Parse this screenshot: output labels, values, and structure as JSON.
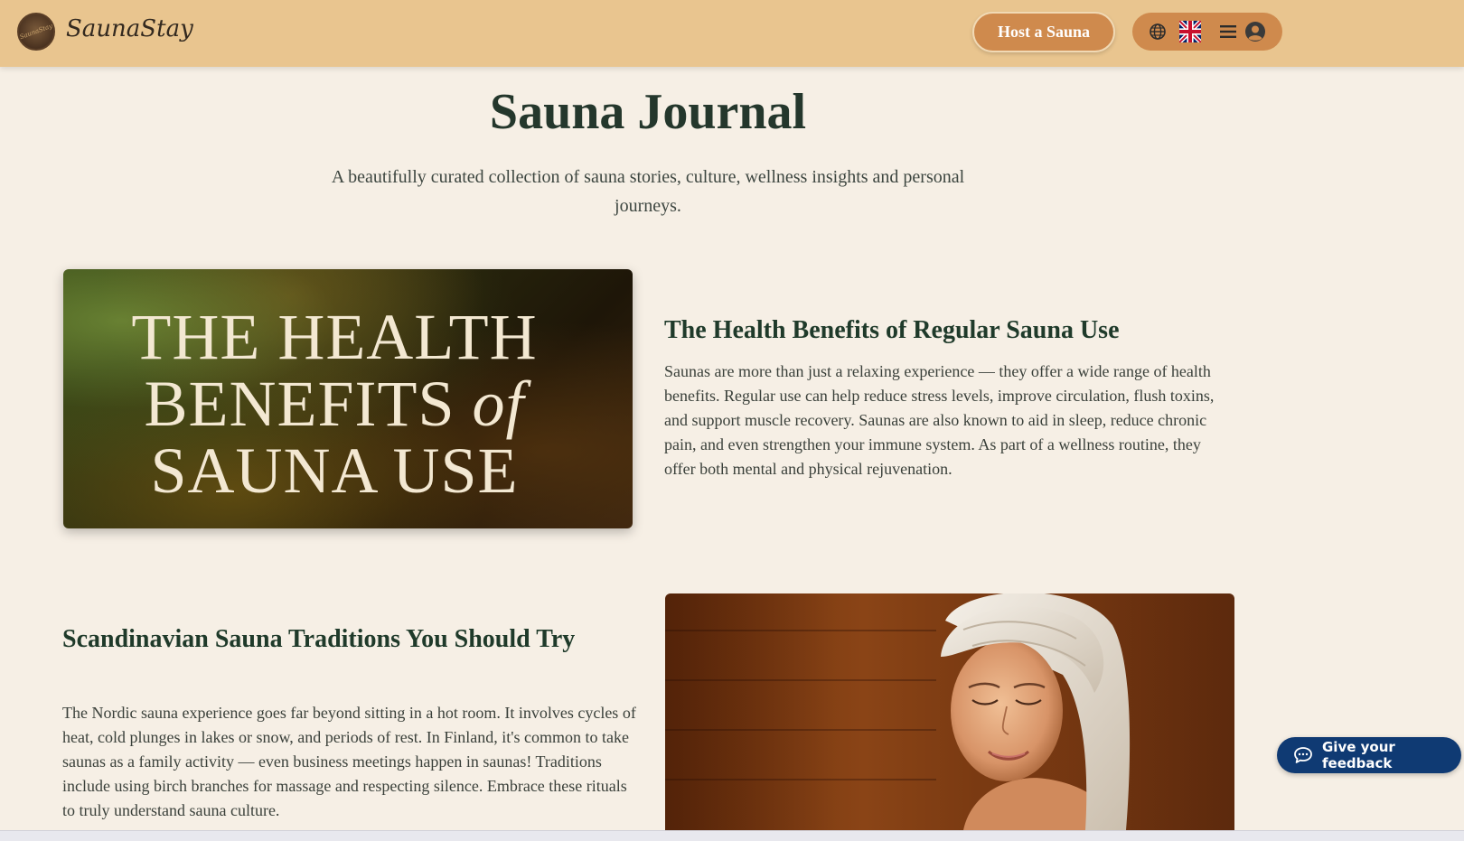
{
  "header": {
    "brand": "SaunaStay",
    "logo_text": "SaunaStay",
    "host_button": "Host a Sauna",
    "icons": [
      "globe-icon",
      "uk-flag-icon",
      "menu-icon",
      "user-icon"
    ]
  },
  "page": {
    "title": "Sauna Journal",
    "subtitle": "A beautifully curated collection of sauna stories, culture, wellness insights and personal journeys."
  },
  "articles": [
    {
      "image_text_line1": "THE HEALTH",
      "image_text_line2a": "BENEFITS",
      "image_text_line2b": "of",
      "image_text_line3": "SAUNA USE",
      "title": "The Health Benefits of Regular Sauna Use",
      "body": "Saunas are more than just a relaxing experience — they offer a wide range of health benefits. Regular use can help reduce stress levels, improve circulation, flush toxins, and support muscle recovery. Saunas are also known to aid in sleep, reduce chronic pain, and even strengthen your immune system. As part of a wellness routine, they offer both mental and physical rejuvenation."
    },
    {
      "title": "Scandinavian Sauna Traditions You Should Try",
      "body": "The Nordic sauna experience goes far beyond sitting in a hot room. It involves cycles of heat, cold plunges in lakes or snow, and periods of rest. In Finland, it's common to take saunas as a family activity — even business meetings happen in saunas! Traditions include using birch branches for massage and respecting silence. Embrace these rituals to truly understand sauna culture."
    }
  ],
  "feedback": {
    "label": "Give your feedback"
  },
  "colors": {
    "header_bg": "#e9c58f",
    "accent": "#cf8a4d",
    "page_bg": "#f6efe5",
    "heading": "#1f3a2a",
    "feedback_bg": "#0f3a73"
  }
}
